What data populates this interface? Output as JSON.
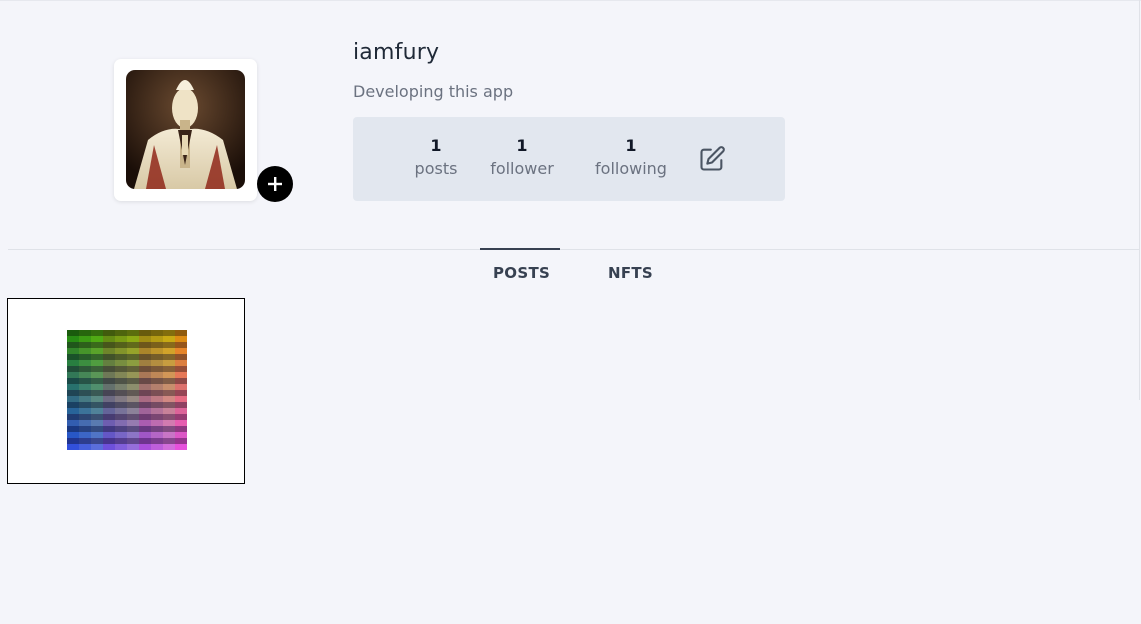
{
  "profile": {
    "username": "iamfury",
    "bio": "Developing this app",
    "avatar_icon": "avatar-image",
    "add_avatar_icon": "plus-icon"
  },
  "stats": {
    "posts": {
      "count": "1",
      "label": "posts"
    },
    "follower": {
      "count": "1",
      "label": "follower"
    },
    "following": {
      "count": "1",
      "label": "following"
    },
    "edit_icon": "edit-icon"
  },
  "tabs": [
    {
      "label": "POSTS",
      "active": true
    },
    {
      "label": "NFTS",
      "active": false
    }
  ],
  "posts": [
    {
      "image": "color-grid-thumbnail"
    }
  ],
  "colors": {
    "background": "#f4f5fa",
    "stats_box": "#e2e7ef",
    "active_tab_indicator": "#374151",
    "add_button": "#000000"
  }
}
